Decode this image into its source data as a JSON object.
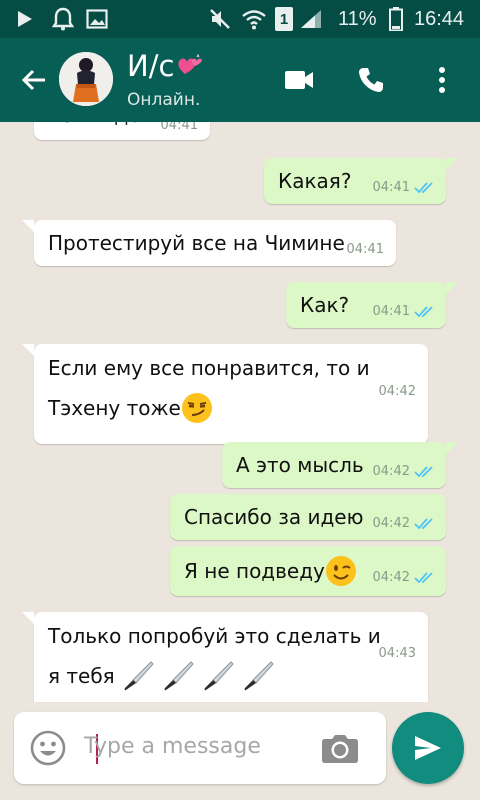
{
  "status_bar": {
    "battery_percent": "11%",
    "time": "16:44",
    "sim_slot": "1"
  },
  "header": {
    "name": "И/с",
    "name_emoji": "heart-emoji",
    "status": "Онлайн."
  },
  "messages": [
    {
      "dir": "in",
      "text": "Есть идея",
      "time": "04:41",
      "partial": true
    },
    {
      "dir": "out",
      "text": "Какая?",
      "time": "04:41",
      "ticks": "read"
    },
    {
      "dir": "in",
      "text": "Протестируй все на Чимине",
      "time": "04:41"
    },
    {
      "dir": "out",
      "text": "Как?",
      "time": "04:41",
      "ticks": "read"
    },
    {
      "dir": "in",
      "line1": "Если ему все понравится, то и",
      "line2": "Тэхену тоже",
      "time": "04:42",
      "emoji": "smirk-emoji"
    },
    {
      "dir": "out",
      "text": "А это мысль",
      "time": "04:42",
      "ticks": "read"
    },
    {
      "dir": "out",
      "text": "Спасибо за идею",
      "time": "04:42",
      "ticks": "read"
    },
    {
      "dir": "out",
      "text": "Я не подведу",
      "time": "04:42",
      "ticks": "read",
      "emoji": "wink-emoji"
    },
    {
      "dir": "in",
      "line1": "Только попробуй это сделать и",
      "line2": "я тебя",
      "time": "04:43",
      "emoji": "knife-emoji"
    }
  ],
  "composer": {
    "placeholder": "Type a message"
  },
  "colors": {
    "header": "#075e54",
    "status_bar": "#054d44",
    "outgoing_bubble": "#dcf8c6",
    "incoming_bubble": "#ffffff",
    "read_ticks": "#4fc3f7",
    "send_button": "#128c7e"
  }
}
